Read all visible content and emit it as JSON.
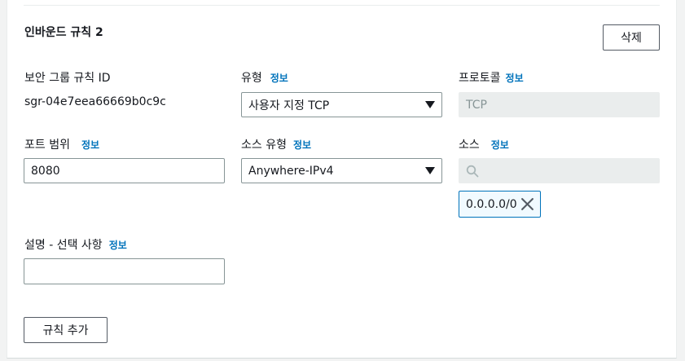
{
  "rule": {
    "title": "인바운드 규칙 2",
    "delete_label": "삭제",
    "info_label": "정보"
  },
  "fields": {
    "sg_rule_id_label": "보안 그룹 규칙 ID",
    "sg_rule_id_value": "sgr-04e7eea66669b0c9c",
    "type_label": "유형",
    "type_value": "사용자 지정 TCP",
    "protocol_label": "프로토콜",
    "protocol_value": "TCP",
    "port_label": "포트 범위",
    "port_value": "8080",
    "source_type_label": "소스 유형",
    "source_type_value": "Anywhere-IPv4",
    "source_label": "소스",
    "source_search_placeholder": "",
    "source_token": "0.0.0.0/0",
    "description_label": "설명 - 선택 사항",
    "description_value": ""
  },
  "add_rule_label": "규칙 추가"
}
